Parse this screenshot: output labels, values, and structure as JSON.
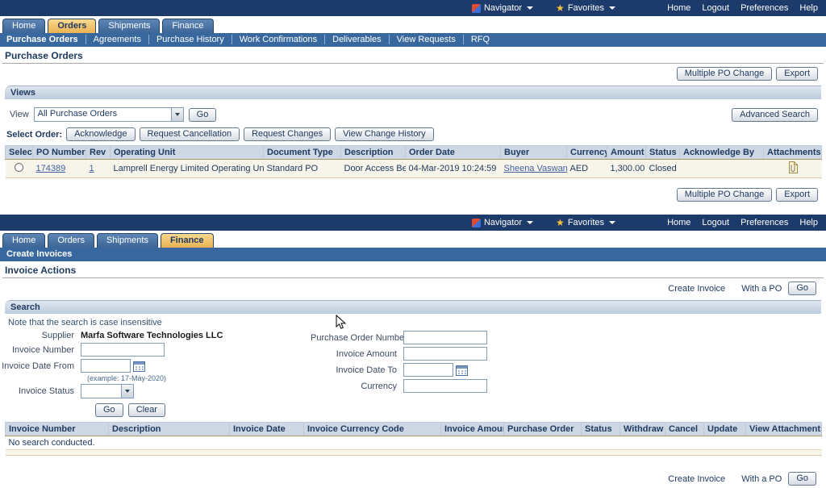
{
  "icons": {
    "star": "★"
  },
  "shared": {
    "topbar": {
      "navigator": "Navigator",
      "favorites": "Favorites",
      "home": "Home",
      "logout": "Logout",
      "preferences": "Preferences",
      "help": "Help"
    },
    "tabs": {
      "home": "Home",
      "orders": "Orders",
      "shipments": "Shipments",
      "finance": "Finance"
    }
  },
  "po": {
    "subnav": [
      "Purchase Orders",
      "Agreements",
      "Purchase History",
      "Work Confirmations",
      "Deliverables",
      "View Requests",
      "RFQ"
    ],
    "title": "Purchase Orders",
    "actions": {
      "multiple_po_change": "Multiple PO Change",
      "export": "Export"
    },
    "views": {
      "header": "Views",
      "view_label": "View",
      "selected_view": "All Purchase Orders",
      "go": "Go",
      "advanced_search": "Advanced Search"
    },
    "select_order": {
      "label": "Select Order:",
      "acknowledge": "Acknowledge",
      "request_cancellation": "Request Cancellation",
      "request_changes": "Request Changes",
      "view_change_history": "View Change History"
    },
    "table": {
      "headers": [
        "Select",
        "PO Number",
        "Rev",
        "Operating Unit",
        "Document Type",
        "Description",
        "Order Date",
        "Buyer",
        "Currency",
        "Amount",
        "Status",
        "Acknowledge By",
        "Attachments"
      ],
      "row": {
        "po_number": "174389",
        "rev": "1",
        "operating_unit": "Lamprell Energy Limited Operating Unit",
        "document_type": "Standard PO",
        "description": "Door Access Bell",
        "order_date": "04-Mar-2019 10:24:59",
        "buyer": "Sheena Vaswani",
        "currency": "AED",
        "amount": "1,300.00",
        "status": "Closed",
        "acknowledge_by": ""
      }
    }
  },
  "inv": {
    "bar_title": "Create Invoices",
    "section_title": "Invoice Actions",
    "create_invoice": {
      "label": "Create Invoice",
      "with_po": "With a PO",
      "go": "Go"
    },
    "search": {
      "header": "Search",
      "note": "Note that the search is case insensitive",
      "supplier_label": "Supplier",
      "supplier_value": "Marfa Software Technologies LLC",
      "invoice_number_label": "Invoice Number",
      "invoice_date_from_label": "Invoice Date From",
      "date_hint": "(example: 17-May-2020)",
      "invoice_status_label": "Invoice Status",
      "po_number_label": "Purchase Order Number",
      "invoice_amount_label": "Invoice Amount",
      "invoice_date_to_label": "Invoice Date To",
      "currency_label": "Currency",
      "go": "Go",
      "clear": "Clear"
    },
    "table": {
      "headers": [
        "Invoice Number",
        "Description",
        "Invoice Date",
        "Invoice Currency Code",
        "Invoice Amount",
        "Purchase Order",
        "Status",
        "Withdraw",
        "Cancel",
        "Update",
        "View Attachments"
      ],
      "empty_message": "No search conducted."
    }
  }
}
